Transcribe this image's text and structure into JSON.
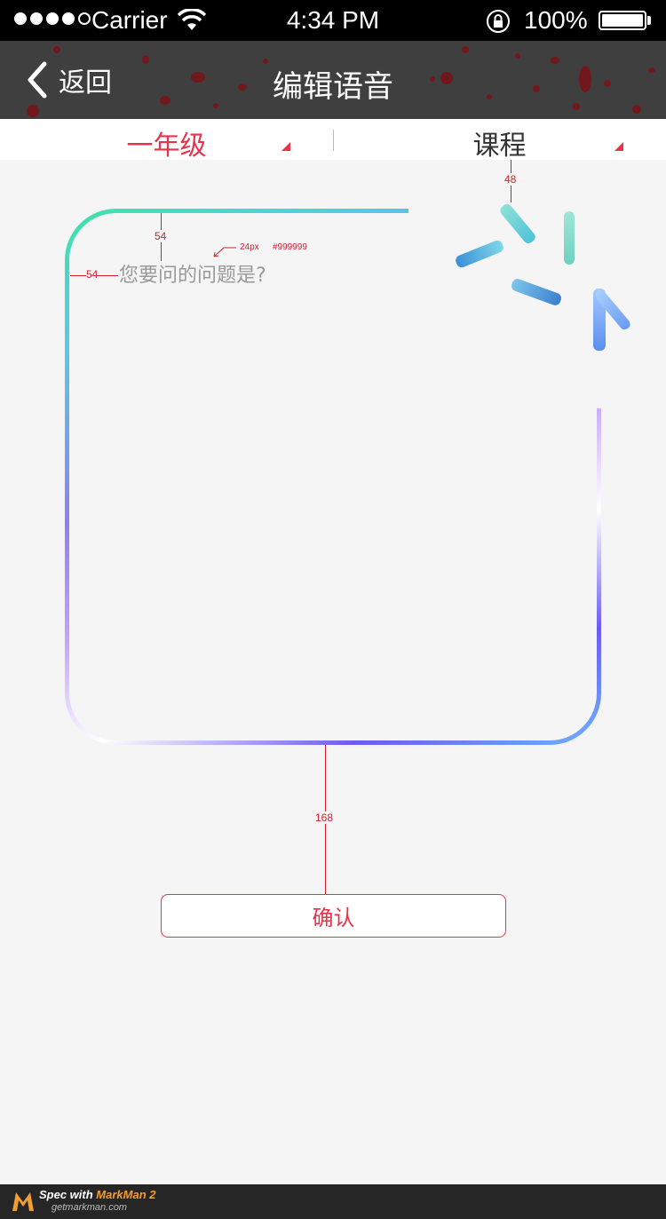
{
  "status_bar": {
    "carrier": "Carrier",
    "time": "4:34 PM",
    "battery_percent": "100%",
    "signal_bars_filled": 4,
    "signal_bars_total": 5
  },
  "nav": {
    "back_label": "返回",
    "title": "编辑语音"
  },
  "filters": {
    "grade": "一年级",
    "course": "课程"
  },
  "question": {
    "placeholder": "您要问的问题是?"
  },
  "annotations": {
    "top_gap": "48",
    "inner_top": "54",
    "inner_left": "54",
    "font_spec": "24px",
    "color_spec": "#999999",
    "button_gap": "168"
  },
  "confirm": {
    "label": "确认"
  },
  "footer": {
    "spec_prefix": "Spec with ",
    "brand": "MarkMan 2",
    "site": "getmarkman.com"
  },
  "colors": {
    "accent": "#e8334a",
    "placeholder": "#999999",
    "nav_bg": "#3f3f3f",
    "page_bg": "#f5f5f5"
  }
}
